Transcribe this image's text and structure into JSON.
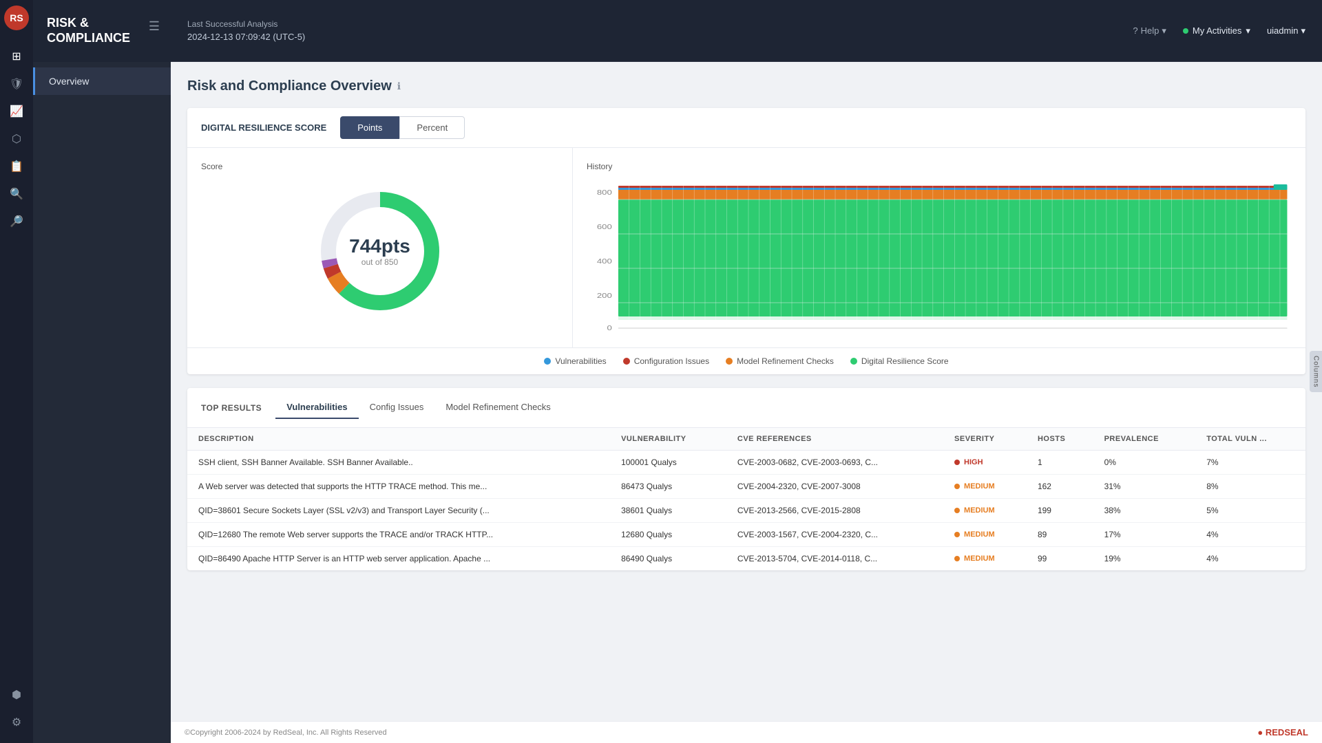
{
  "app": {
    "logo_text": "RS",
    "title": "RISK & COMPLIANCE"
  },
  "topbar": {
    "analysis_title": "Last Successful Analysis",
    "analysis_date": "2024-12-13 07:09:42 (UTC-5)",
    "help_label": "Help",
    "activities_label": "My Activities",
    "user_label": "uiadmin"
  },
  "sidebar": {
    "nav_item": "Overview"
  },
  "page": {
    "title": "Risk and Compliance Overview"
  },
  "score_card": {
    "title": "DIGITAL RESILIENCE SCORE",
    "tab_points": "Points",
    "tab_percent": "Percent",
    "score_label": "Score",
    "history_label": "History",
    "score_value": "744pts",
    "score_sub": "out of 850",
    "y_axis": [
      "800",
      "600",
      "400",
      "200",
      "0"
    ]
  },
  "legend": {
    "items": [
      {
        "label": "Vulnerabilities",
        "color": "#3498db"
      },
      {
        "label": "Configuration Issues",
        "color": "#c0392b"
      },
      {
        "label": "Model Refinement Checks",
        "color": "#e67e22"
      },
      {
        "label": "Digital Resilience Score",
        "color": "#2ecc71"
      }
    ]
  },
  "top_results": {
    "title": "TOP RESULTS",
    "tabs": [
      "Vulnerabilities",
      "Config Issues",
      "Model Refinement Checks"
    ],
    "active_tab": 0,
    "columns": [
      "DESCRIPTION",
      "VULNERABILITY",
      "CVE REFERENCES",
      "SEVERITY",
      "HOSTS",
      "PREVALENCE",
      "TOTAL VULN ..."
    ],
    "rows": [
      {
        "description": "SSH client, SSH Banner Available. SSH Banner Available..",
        "vulnerability": "100001 Qualys",
        "cve": "CVE-2003-0682, CVE-2003-0693, C...",
        "severity": "HIGH",
        "sev_level": "high",
        "hosts": "1",
        "prevalence": "0%",
        "total": "7%"
      },
      {
        "description": "A Web server was detected that supports the HTTP TRACE method. This me...",
        "vulnerability": "86473 Qualys",
        "cve": "CVE-2004-2320, CVE-2007-3008",
        "severity": "MEDIUM",
        "sev_level": "medium",
        "hosts": "162",
        "prevalence": "31%",
        "total": "8%"
      },
      {
        "description": "QID=38601 Secure Sockets Layer (SSL v2/v3) and Transport Layer Security (...",
        "vulnerability": "38601 Qualys",
        "cve": "CVE-2013-2566, CVE-2015-2808",
        "severity": "MEDIUM",
        "sev_level": "medium",
        "hosts": "199",
        "prevalence": "38%",
        "total": "5%"
      },
      {
        "description": "QID=12680 The remote Web server supports the TRACE and/or TRACK HTTP...",
        "vulnerability": "12680 Qualys",
        "cve": "CVE-2003-1567, CVE-2004-2320, C...",
        "severity": "MEDIUM",
        "sev_level": "medium",
        "hosts": "89",
        "prevalence": "17%",
        "total": "4%"
      },
      {
        "description": "QID=86490 Apache HTTP Server is an HTTP web server application. Apache ...",
        "vulnerability": "86490 Qualys",
        "cve": "CVE-2013-5704, CVE-2014-0118, C...",
        "severity": "MEDIUM",
        "sev_level": "medium",
        "hosts": "99",
        "prevalence": "19%",
        "total": "4%"
      }
    ]
  },
  "footer": {
    "copyright": "©Copyright 2006-2024 by RedSeal, Inc. All Rights Reserved",
    "logo": "● REDSEAL"
  },
  "icons": {
    "hamburger": "☰",
    "grid": "⊞",
    "shield": "⛨",
    "chart": "📊",
    "network": "⬡",
    "search": "🔍",
    "settings": "⚙",
    "topology": "⬢",
    "help": "?",
    "chevron_down": "▾",
    "columns_text": "Columns"
  }
}
